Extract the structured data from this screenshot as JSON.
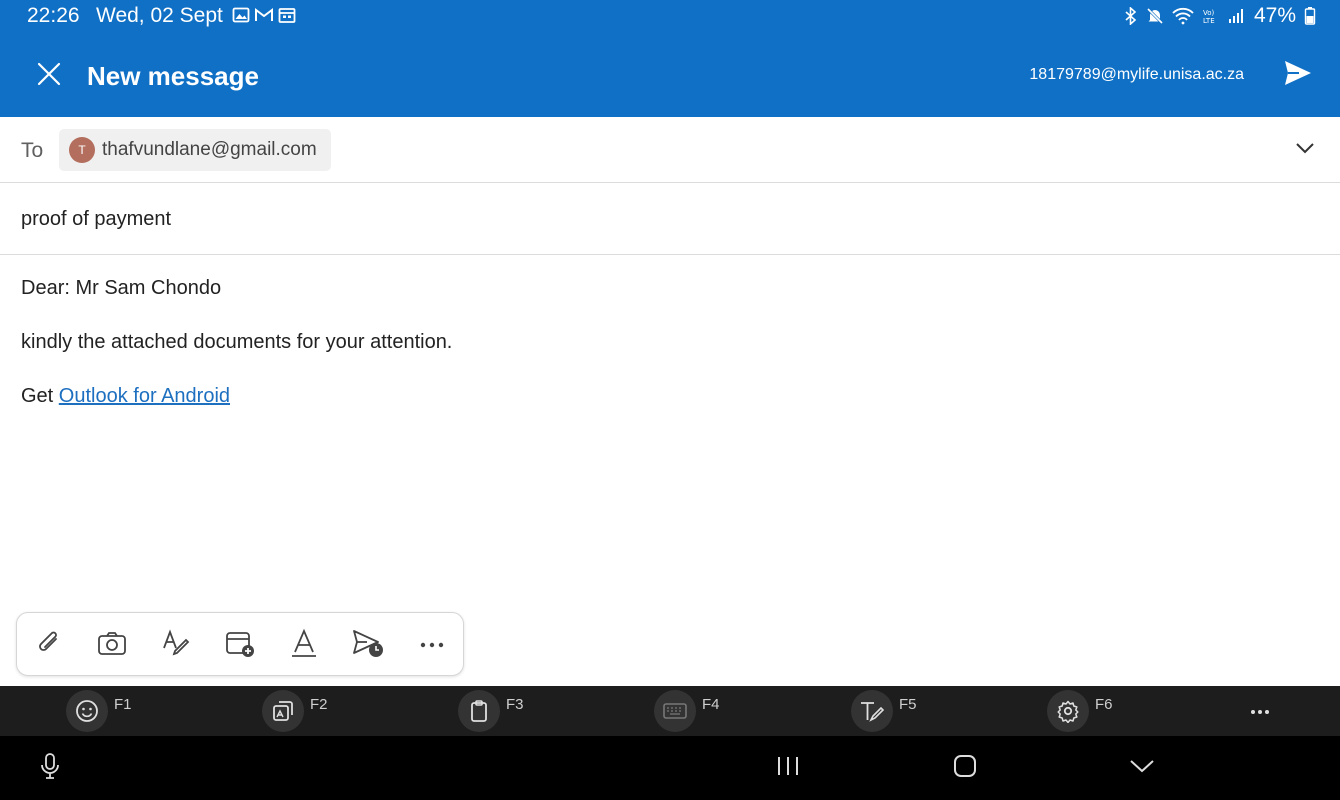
{
  "status_bar": {
    "time": "22:26",
    "date": "Wed, 02 Sept",
    "battery": "47%",
    "notification_icons": [
      "gallery-icon",
      "gmail-icon",
      "calendar-icon"
    ],
    "system_icons": [
      "bluetooth-icon",
      "mute-icon",
      "wifi-icon",
      "volte-icon",
      "signal-icon",
      "battery-icon"
    ]
  },
  "header": {
    "title": "New message",
    "account": "18179789@mylife.unisa.ac.za",
    "background": "#1070c5"
  },
  "compose": {
    "to_label": "To",
    "recipient": {
      "initial": "T",
      "email": "thafvundlane@gmail.com",
      "avatar_color": "#b36e5d"
    },
    "subject": "proof of payment",
    "body": {
      "greeting": "Dear: Mr Sam Chondo",
      "message": "kindly the attached documents for your attention.",
      "signature_prefix": "Get ",
      "signature_link": "Outlook for Android"
    }
  },
  "toolbar": {
    "items": [
      "attach-icon",
      "camera-icon",
      "format-icon",
      "add-event-icon",
      "font-icon",
      "schedule-send-icon",
      "more-icon"
    ]
  },
  "keyboard_row": {
    "keys": [
      {
        "label": "F1",
        "icon": "emoji-icon"
      },
      {
        "label": "F2",
        "icon": "sticker-icon"
      },
      {
        "label": "F3",
        "icon": "clipboard-icon"
      },
      {
        "label": "F4",
        "icon": "keyboard-icon"
      },
      {
        "label": "F5",
        "icon": "handwriting-icon"
      },
      {
        "label": "F6",
        "icon": "settings-icon"
      }
    ]
  },
  "nav_bar": {
    "items": [
      "mic-icon",
      "recents-icon",
      "home-icon",
      "hide-keyboard-icon"
    ]
  }
}
